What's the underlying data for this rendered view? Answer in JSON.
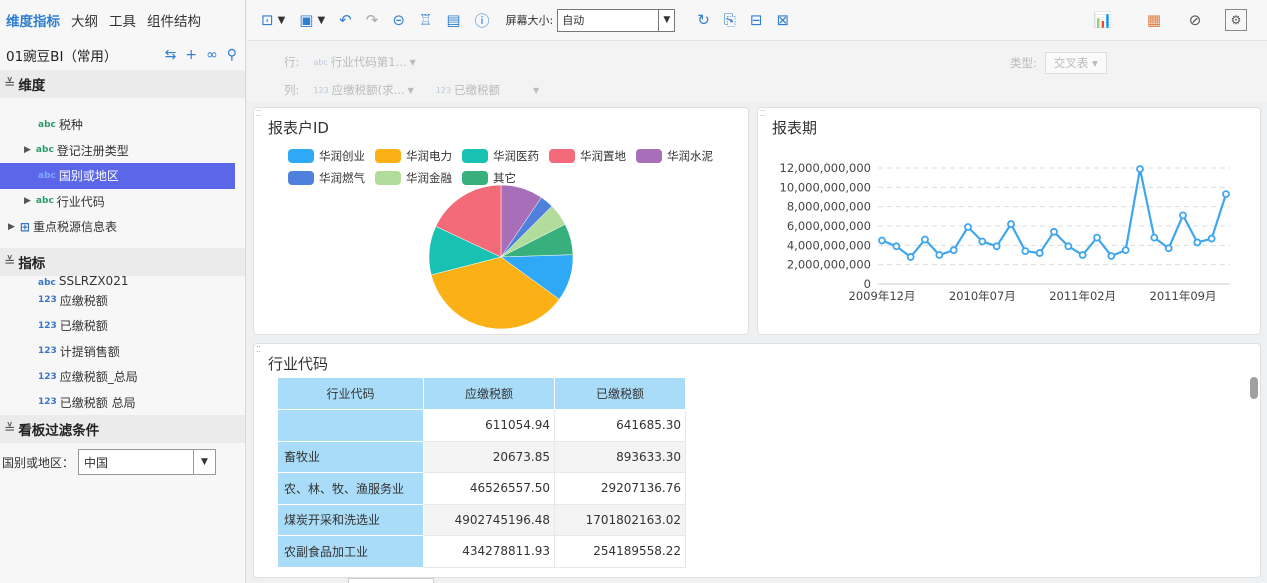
{
  "left": {
    "tabs": [
      "维度指标",
      "大纲",
      "工具",
      "组件结构"
    ],
    "dataset": "01豌豆BI（常用）",
    "dimension_header": "维度",
    "dimensions": [
      {
        "label": "税种",
        "type": "abc"
      },
      {
        "label": "登记注册类型",
        "type": "abc",
        "expandable": true
      },
      {
        "label": "国别或地区",
        "type": "abc",
        "selected": true
      },
      {
        "label": "行业代码",
        "type": "abc",
        "expandable": true
      },
      {
        "label": "重点税源信息表",
        "type": "table",
        "expandable": true
      }
    ],
    "measure_header": "指标",
    "measure_cut": "SSLRZX021",
    "measures": [
      "应缴税额",
      "已缴税额",
      "计提销售额",
      "应缴税额_总局",
      "已缴税额 总局"
    ],
    "filter_header": "看板过滤条件",
    "filter": {
      "label": "国别或地区：",
      "value": "中国"
    }
  },
  "toolbar": {
    "screen_label": "屏幕大小:",
    "screen_value": "自动"
  },
  "rowcol": {
    "row_label": "行:",
    "row_field": "行业代码第1...",
    "col_label": "列:",
    "col_fields": [
      "应缴税额(求...",
      "已缴税额"
    ],
    "type_label": "类型:",
    "type_value": "交叉表"
  },
  "panel1": {
    "title": "报表户ID",
    "chart_data": {
      "type": "pie",
      "legend": [
        "华润创业",
        "华润电力",
        "华润医药",
        "华润置地",
        "华润水泥",
        "华润燃气",
        "华润金融",
        "其它"
      ],
      "colors": [
        "#2fa8f5",
        "#fbb116",
        "#19c1b2",
        "#f36a78",
        "#a86fb9",
        "#4f80db",
        "#b1dc9b",
        "#37b07e"
      ],
      "values": [
        10.5,
        36,
        11,
        18,
        9.5,
        3,
        5,
        7
      ]
    }
  },
  "panel2": {
    "title": "报表期",
    "chart_data": {
      "type": "line",
      "x_tick_labels": [
        "2009年12月",
        "2010年07月",
        "2011年02月",
        "2011年09月"
      ],
      "y_tick_labels": [
        "0",
        "2,000,000,000",
        "4,000,000,000",
        "6,000,000,000",
        "8,000,000,000",
        "10,000,000,000",
        "12,000,000,000"
      ],
      "ylim": [
        0,
        12000000000
      ],
      "grid": true,
      "color": "#3fa6ee",
      "values": [
        4500000000,
        3900000000,
        2800000000,
        4600000000,
        3000000000,
        3500000000,
        5900000000,
        4400000000,
        3900000000,
        6200000000,
        3400000000,
        3200000000,
        5400000000,
        3900000000,
        3000000000,
        4800000000,
        2900000000,
        3500000000,
        11900000000,
        4800000000,
        3700000000,
        7100000000,
        4300000000,
        4700000000,
        9300000000
      ]
    }
  },
  "panel3": {
    "title": "行业代码",
    "columns": [
      "行业代码",
      "应缴税额",
      "已缴税额"
    ],
    "rows": [
      [
        "",
        "611054.94",
        "641685.30"
      ],
      [
        "畜牧业",
        "20673.85",
        "893633.30"
      ],
      [
        "农、林、牧、渔服务业",
        "46526557.50",
        "29207136.76"
      ],
      [
        "煤炭开采和洗选业",
        "4902745196.48",
        "1701802163.02"
      ],
      [
        "农副食品加工业",
        "434278811.93",
        "254189558.22"
      ]
    ]
  }
}
